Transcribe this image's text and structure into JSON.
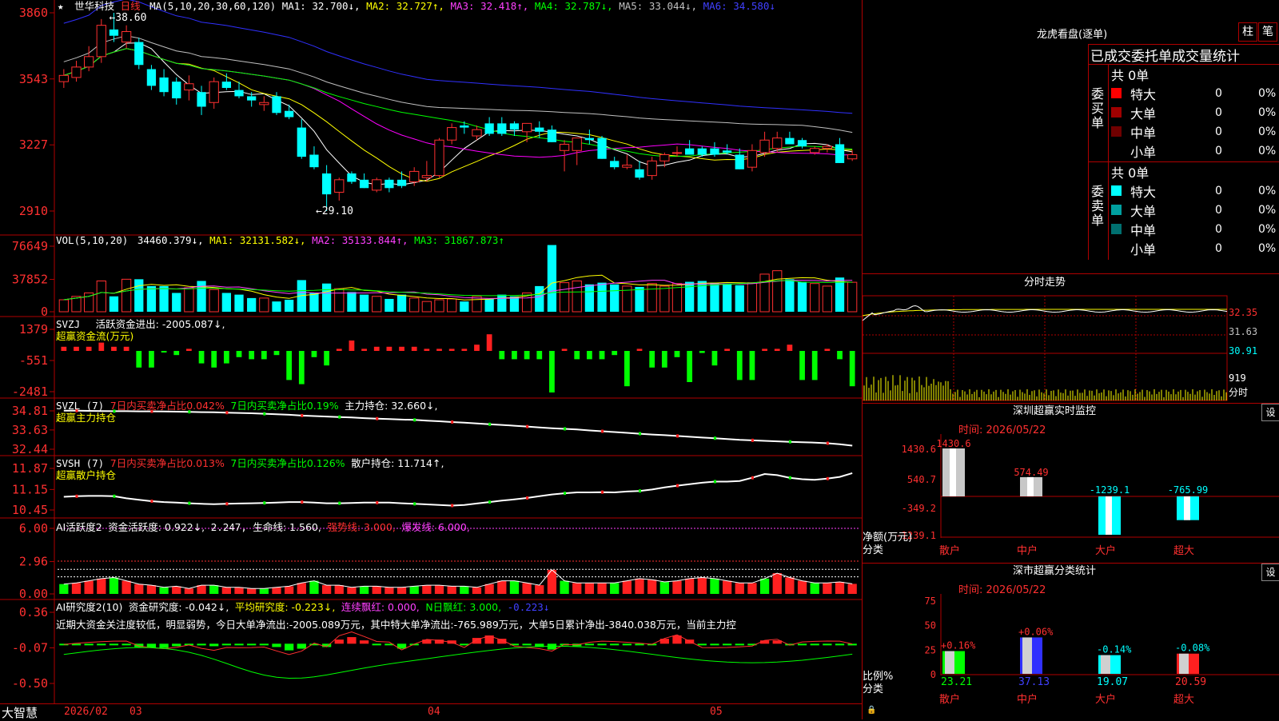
{
  "colors": {
    "up": "#ff3030",
    "down": "#00ffff",
    "frame": "#b00000",
    "ma1": "#ffffff",
    "ma2": "#ffff00",
    "ma3": "#ff00ff",
    "ma4": "#00ff00",
    "ma5": "#c0c0c0",
    "ma6": "#3030ff",
    "yellow": "#ffff00",
    "green": "#00ff00",
    "red": "#ff2020"
  },
  "main": {
    "star": "★",
    "stock_name": "世华科技",
    "period": "日线",
    "ma_params": "MA(5,10,20,30,60,120)",
    "ma1": "MA1: 32.700↓,",
    "ma2": "MA2: 32.727↑,",
    "ma3": "MA3: 32.418↑,",
    "ma4": "MA4: 32.787↓,",
    "ma5": "MA5: 33.044↓,",
    "ma6": "MA6: 34.580↓",
    "high_mark": "38.60",
    "low_mark": "29.10",
    "y_ticks": [
      "3860",
      "3543",
      "3227",
      "2910"
    ]
  },
  "chart_data": [
    {
      "type": "candlestick",
      "title": "世华科技 日线",
      "ylim": [
        29.1,
        38.6
      ],
      "y_ticks": [
        38.6,
        35.43,
        32.27,
        29.1
      ],
      "x_month_labels": [
        "2026/02",
        "03",
        "04",
        "05"
      ],
      "candles_ohlc": [
        [
          35.3,
          35.9,
          35.0,
          35.6
        ],
        [
          35.5,
          36.3,
          35.3,
          36.0
        ],
        [
          36.0,
          37.0,
          35.8,
          36.5
        ],
        [
          36.5,
          38.3,
          36.2,
          38.0
        ],
        [
          37.8,
          38.6,
          37.2,
          37.5
        ],
        [
          37.2,
          38.0,
          36.9,
          37.7
        ],
        [
          37.2,
          37.4,
          35.9,
          36.1
        ],
        [
          35.9,
          36.1,
          34.9,
          35.1
        ],
        [
          35.5,
          35.9,
          34.6,
          34.8
        ],
        [
          35.3,
          35.5,
          34.2,
          34.5
        ],
        [
          34.9,
          35.6,
          34.4,
          35.2
        ],
        [
          34.8,
          35.1,
          33.7,
          34.1
        ],
        [
          34.3,
          35.5,
          34.0,
          35.3
        ],
        [
          35.3,
          35.7,
          34.9,
          35.0
        ],
        [
          34.9,
          35.3,
          34.5,
          34.6
        ],
        [
          34.6,
          34.8,
          34.1,
          34.4
        ],
        [
          34.2,
          34.6,
          33.9,
          34.3
        ],
        [
          34.6,
          34.8,
          33.7,
          33.8
        ],
        [
          33.9,
          34.2,
          33.5,
          33.6
        ],
        [
          33.1,
          33.5,
          31.6,
          31.7
        ],
        [
          31.8,
          32.2,
          31.1,
          31.2
        ],
        [
          30.9,
          31.3,
          29.1,
          29.9
        ],
        [
          30.0,
          30.7,
          29.6,
          30.6
        ],
        [
          30.9,
          31.0,
          30.4,
          30.5
        ],
        [
          30.6,
          30.9,
          30.2,
          30.2
        ],
        [
          30.1,
          30.7,
          30.0,
          30.6
        ],
        [
          30.6,
          30.7,
          30.0,
          30.2
        ],
        [
          30.6,
          31.0,
          30.2,
          30.3
        ],
        [
          30.5,
          31.2,
          30.3,
          31.0
        ],
        [
          30.7,
          31.5,
          30.5,
          30.8
        ],
        [
          30.8,
          32.6,
          30.7,
          32.5
        ],
        [
          32.5,
          33.3,
          32.3,
          33.1
        ],
        [
          33.2,
          33.4,
          32.8,
          33.1
        ],
        [
          32.7,
          33.2,
          32.5,
          33.0
        ],
        [
          33.3,
          33.6,
          32.7,
          32.8
        ],
        [
          33.3,
          33.6,
          32.7,
          32.8
        ],
        [
          33.3,
          33.4,
          32.7,
          33.0
        ],
        [
          32.9,
          33.1,
          32.4,
          33.3
        ],
        [
          33.1,
          33.4,
          32.6,
          32.9
        ],
        [
          33.0,
          33.2,
          32.4,
          32.4
        ],
        [
          32.0,
          32.5,
          31.0,
          32.3
        ],
        [
          32.0,
          32.5,
          31.3,
          32.6
        ],
        [
          32.6,
          33.0,
          32.3,
          32.5
        ],
        [
          32.6,
          32.7,
          31.6,
          31.6
        ],
        [
          31.5,
          31.7,
          31.1,
          31.2
        ],
        [
          31.2,
          31.8,
          31.1,
          31.3
        ],
        [
          31.1,
          31.5,
          30.6,
          30.7
        ],
        [
          30.8,
          31.7,
          30.6,
          31.5
        ],
        [
          31.5,
          31.9,
          31.2,
          31.8
        ],
        [
          31.9,
          32.2,
          31.7,
          31.9
        ],
        [
          32.1,
          32.5,
          31.8,
          31.8
        ],
        [
          32.1,
          32.2,
          31.7,
          31.8
        ],
        [
          32.1,
          32.4,
          31.7,
          31.8
        ],
        [
          32.0,
          32.3,
          31.8,
          31.9
        ],
        [
          31.8,
          32.1,
          31.1,
          31.1
        ],
        [
          31.2,
          32.3,
          31.0,
          32.0
        ],
        [
          31.9,
          32.9,
          31.7,
          32.5
        ],
        [
          32.1,
          32.9,
          31.9,
          32.6
        ],
        [
          32.6,
          32.9,
          32.3,
          32.3
        ],
        [
          32.5,
          32.6,
          32.1,
          32.2
        ],
        [
          31.9,
          32.2,
          31.8,
          32.1
        ],
        [
          32.1,
          32.3,
          31.9,
          32.2
        ],
        [
          32.3,
          32.6,
          31.4,
          31.4
        ],
        [
          31.6,
          32.0,
          31.5,
          31.8
        ]
      ]
    },
    {
      "type": "bar",
      "name": "VOL(5,10,20)",
      "ylim": [
        0,
        76649
      ],
      "y_ticks": [
        0,
        37852,
        76649
      ],
      "values": [
        14000,
        18000,
        22000,
        36000,
        18000,
        38000,
        38000,
        30000,
        30000,
        22000,
        28000,
        36000,
        26000,
        22000,
        20000,
        16000,
        16000,
        12000,
        14000,
        37000,
        22000,
        33000,
        27000,
        23000,
        20000,
        18000,
        15000,
        20000,
        16000,
        12000,
        14000,
        15000,
        12000,
        18000,
        15000,
        20000,
        18000,
        22000,
        30000,
        78000,
        34000,
        36000,
        32000,
        34000,
        32000,
        30000,
        29000,
        33000,
        30000,
        33000,
        35000,
        36000,
        34000,
        33000,
        31000,
        34000,
        44000,
        48000,
        38000,
        35000,
        33000,
        30000,
        40000,
        34460
      ],
      "lines": [
        {
          "name": "MA1",
          "value": 32131.582
        },
        {
          "name": "MA2",
          "value": 35133.844
        },
        {
          "name": "MA3",
          "value": 31867.873
        }
      ]
    }
  ],
  "vol": {
    "label": "VOL(5,10,20)",
    "v": "34460.379↓,",
    "ma1": "MA1: 32131.582↓,",
    "ma2": "MA2: 35133.844↑,",
    "ma3": "MA3: 31867.873↑",
    "y_ticks": [
      "76649",
      "37852",
      "0"
    ]
  },
  "svzj": {
    "label": "SVZJ",
    "active": "活跃资金进出: -2005.087↓,",
    "sub": "超赢资金流(万元)",
    "y_ticks": [
      "1379",
      "-551",
      "-2481"
    ],
    "values": [
      2,
      2,
      2,
      4,
      2,
      2,
      -8,
      -8,
      0,
      -2,
      1,
      -6,
      -8,
      -6,
      -3,
      -4,
      -4,
      -2,
      -14,
      -16,
      -3,
      -7,
      1,
      5,
      1,
      2,
      2,
      2,
      2,
      1,
      1,
      1,
      1,
      3,
      8,
      -4,
      -4,
      -4,
      -4,
      -20,
      1,
      -4,
      -4,
      -4,
      -2,
      -17,
      1,
      -8,
      -8,
      -3,
      -15,
      -1,
      -7,
      1,
      -14,
      -14,
      1,
      1,
      3,
      -14,
      -14,
      1,
      -4,
      -17
    ]
  },
  "svzl": {
    "label": "SVZL (7)",
    "t1": "7日内买卖净占比0.042%",
    "t2": "7日内买卖净占比0.19%",
    "t3": "主力持仓: 32.660↓,",
    "sub": "超赢主力持仓",
    "y_ticks": [
      "34.81",
      "33.63",
      "32.44"
    ],
    "values": [
      34.82,
      34.82,
      34.81,
      34.8,
      34.79,
      34.79,
      34.78,
      34.78,
      34.77,
      34.76,
      34.75,
      34.73,
      34.72,
      34.7,
      34.68,
      34.66,
      34.63,
      34.6,
      34.57,
      34.52,
      34.49,
      34.46,
      34.43,
      34.4,
      34.36,
      34.33,
      34.3,
      34.27,
      34.25,
      34.21,
      34.17,
      34.12,
      34.08,
      34.03,
      33.98,
      33.94,
      33.89,
      33.84,
      33.79,
      33.74,
      33.7,
      33.66,
      33.6,
      33.55,
      33.5,
      33.45,
      33.4,
      33.35,
      33.31,
      33.26,
      33.21,
      33.16,
      33.12,
      33.07,
      33.02,
      32.99,
      32.96,
      32.93,
      32.9,
      32.87,
      32.85,
      32.81,
      32.75,
      32.66
    ]
  },
  "svsh": {
    "label": "SVSH (7)",
    "t1": "7日内买卖净占比0.013%",
    "t2": "7日内买卖净占比0.126%",
    "t3": "散户持仓: 11.714↑,",
    "sub": "超赢散户持仓",
    "y_ticks": [
      "11.87",
      "11.15",
      "10.45"
    ],
    "values": [
      10.9,
      10.92,
      10.93,
      10.93,
      10.92,
      10.85,
      10.8,
      10.75,
      10.72,
      10.7,
      10.68,
      10.66,
      10.65,
      10.66,
      10.67,
      10.68,
      10.69,
      10.7,
      10.72,
      10.72,
      10.7,
      10.68,
      10.68,
      10.69,
      10.7,
      10.7,
      10.7,
      10.68,
      10.66,
      10.64,
      10.62,
      10.6,
      10.62,
      10.67,
      10.72,
      10.77,
      10.81,
      10.86,
      10.92,
      10.98,
      11.02,
      11.05,
      11.05,
      11.06,
      11.05,
      11.08,
      11.1,
      11.15,
      11.22,
      11.28,
      11.33,
      11.38,
      11.42,
      11.42,
      11.44,
      11.55,
      11.68,
      11.64,
      11.55,
      11.5,
      11.48,
      11.52,
      11.58,
      11.71
    ]
  },
  "ai1": {
    "label": "AI活跃度2",
    "t1": "资金活跃度: 0.922↓,",
    "t2": "2.247,",
    "t3": "生命线: 1.560,",
    "t4": "强势线: 3.000,",
    "t5": "爆发线: 6.000,",
    "y_ticks": [
      "6.00",
      "2.96",
      "0.00"
    ],
    "values": [
      0.9,
      1.0,
      1.2,
      1.4,
      1.5,
      1.2,
      0.9,
      0.8,
      0.6,
      0.7,
      0.5,
      0.8,
      0.8,
      0.6,
      0.6,
      0.5,
      0.5,
      0.6,
      0.7,
      1.0,
      1.2,
      0.8,
      0.8,
      0.6,
      0.7,
      0.7,
      0.6,
      0.6,
      0.7,
      0.8,
      0.8,
      0.7,
      0.7,
      0.6,
      0.9,
      1.2,
      1.2,
      1.0,
      0.8,
      2.2,
      1.2,
      1.0,
      1.0,
      1.0,
      1.0,
      1.2,
      1.4,
      1.3,
      1.1,
      1.2,
      1.4,
      1.5,
      1.4,
      1.2,
      1.0,
      1.0,
      1.4,
      1.9,
      1.5,
      1.2,
      1.0,
      1.0,
      1.1,
      0.92
    ]
  },
  "ai2": {
    "label": "AI研究度2(10)",
    "t1": "资金研究度: -0.042↓,",
    "t2": "平均研究度: -0.223↓,",
    "t3": "连续飘红: 0.000,",
    "t4": "N日飘红: 3.000,",
    "t5": "-0.223↓",
    "comment": "近期大资金关注度较低，明显弱势，今日大单净流出:-2005.089万元，其中特大单净流出:-765.989万元，大单5日累计净出-3840.038万元，当前主力控",
    "y_ticks": [
      "0.36",
      "-0.07",
      "-0.50"
    ],
    "values": [
      -0.02,
      -0.02,
      -0.02,
      -0.02,
      -0.02,
      -0.02,
      -0.06,
      -0.07,
      -0.07,
      -0.05,
      -0.02,
      -0.04,
      -0.05,
      -0.02,
      -0.02,
      -0.02,
      -0.02,
      -0.06,
      -0.1,
      -0.08,
      -0.02,
      -0.06,
      0.03,
      0.06,
      0.02,
      -0.02,
      -0.02,
      -0.08,
      -0.02,
      0.03,
      0.03,
      0.02,
      -0.02,
      0.05,
      0.08,
      0.04,
      -0.02,
      -0.04,
      -0.06,
      -0.09,
      -0.04,
      -0.05,
      -0.03,
      -0.02,
      -0.02,
      -0.02,
      -0.02,
      -0.02,
      0.04,
      0.08,
      0.03,
      -0.02,
      -0.02,
      -0.02,
      -0.02,
      -0.02,
      0.02,
      0.02,
      -0.04,
      -0.02,
      -0.02,
      -0.02,
      -0.02,
      -0.04
    ]
  },
  "footer": {
    "brand": "大智慧",
    "dates": [
      "2026/02",
      "03",
      "04",
      "05"
    ]
  },
  "right": {
    "dragon_title": "龙虎看盘(逐单)",
    "tab_bar": "柱",
    "tab_pen": "笔",
    "stat_title": "已成交委托单成交量统计",
    "buy_group_label": "委买单",
    "sell_group_label": "委卖单",
    "buy_total": "共 0单",
    "sell_total": "共 0单",
    "buy_rows": [
      {
        "name": "特大",
        "count": "0",
        "pct": "0%",
        "color": "#ff0000"
      },
      {
        "name": "大单",
        "count": "0",
        "pct": "0%",
        "color": "#a00000"
      },
      {
        "name": "中单",
        "count": "0",
        "pct": "0%",
        "color": "#700000"
      },
      {
        "name": "小单",
        "count": "0",
        "pct": "0%",
        "color": ""
      }
    ],
    "sell_rows": [
      {
        "name": "特大",
        "count": "0",
        "pct": "0%",
        "color": "#00ffff"
      },
      {
        "name": "大单",
        "count": "0",
        "pct": "0%",
        "color": "#00a0a0"
      },
      {
        "name": "中单",
        "count": "0",
        "pct": "0%",
        "color": "#007070"
      },
      {
        "name": "小单",
        "count": "0",
        "pct": "0%",
        "color": ""
      }
    ],
    "intraday_title": "分时走势",
    "intraday_ticks": [
      "32.35",
      "31.63",
      "30.91",
      "919",
      "分时"
    ],
    "sz_title": "深圳超赢实时监控",
    "sz_settings": "设",
    "sz_time": "时间: 2026/05/22",
    "sz_ylabels": [
      "1430.6",
      "540.7",
      "-349.2",
      "-1239.1"
    ],
    "sz_axis_title": "净额(万元)",
    "sz_cat_title": "分类",
    "sz_categories": [
      "散户",
      "中户",
      "大户",
      "超大"
    ],
    "sz_values": [
      1430.6,
      574.49,
      -1239.1,
      -765.99
    ],
    "sz_value_labels": [
      "1430.6",
      "574.49",
      "-1239.1",
      "-765.99"
    ],
    "sc_title": "深市超赢分类统计",
    "sc_settings": "设",
    "sc_time": "时间: 2026/05/22",
    "sc_ylabels": [
      "75",
      "50",
      "25",
      "0"
    ],
    "sc_axis_title": "比例%",
    "sc_cat_title": "分类",
    "sc_categories": [
      "散户",
      "中户",
      "大户",
      "超大"
    ],
    "sc_values": [
      23.21,
      37.13,
      19.07,
      20.59
    ],
    "sc_value_labels": [
      "23.21",
      "37.13",
      "19.07",
      "20.59"
    ],
    "sc_change_labels": [
      "+0.16%",
      "+0.06%",
      "-0.14%",
      "-0.08%"
    ]
  }
}
